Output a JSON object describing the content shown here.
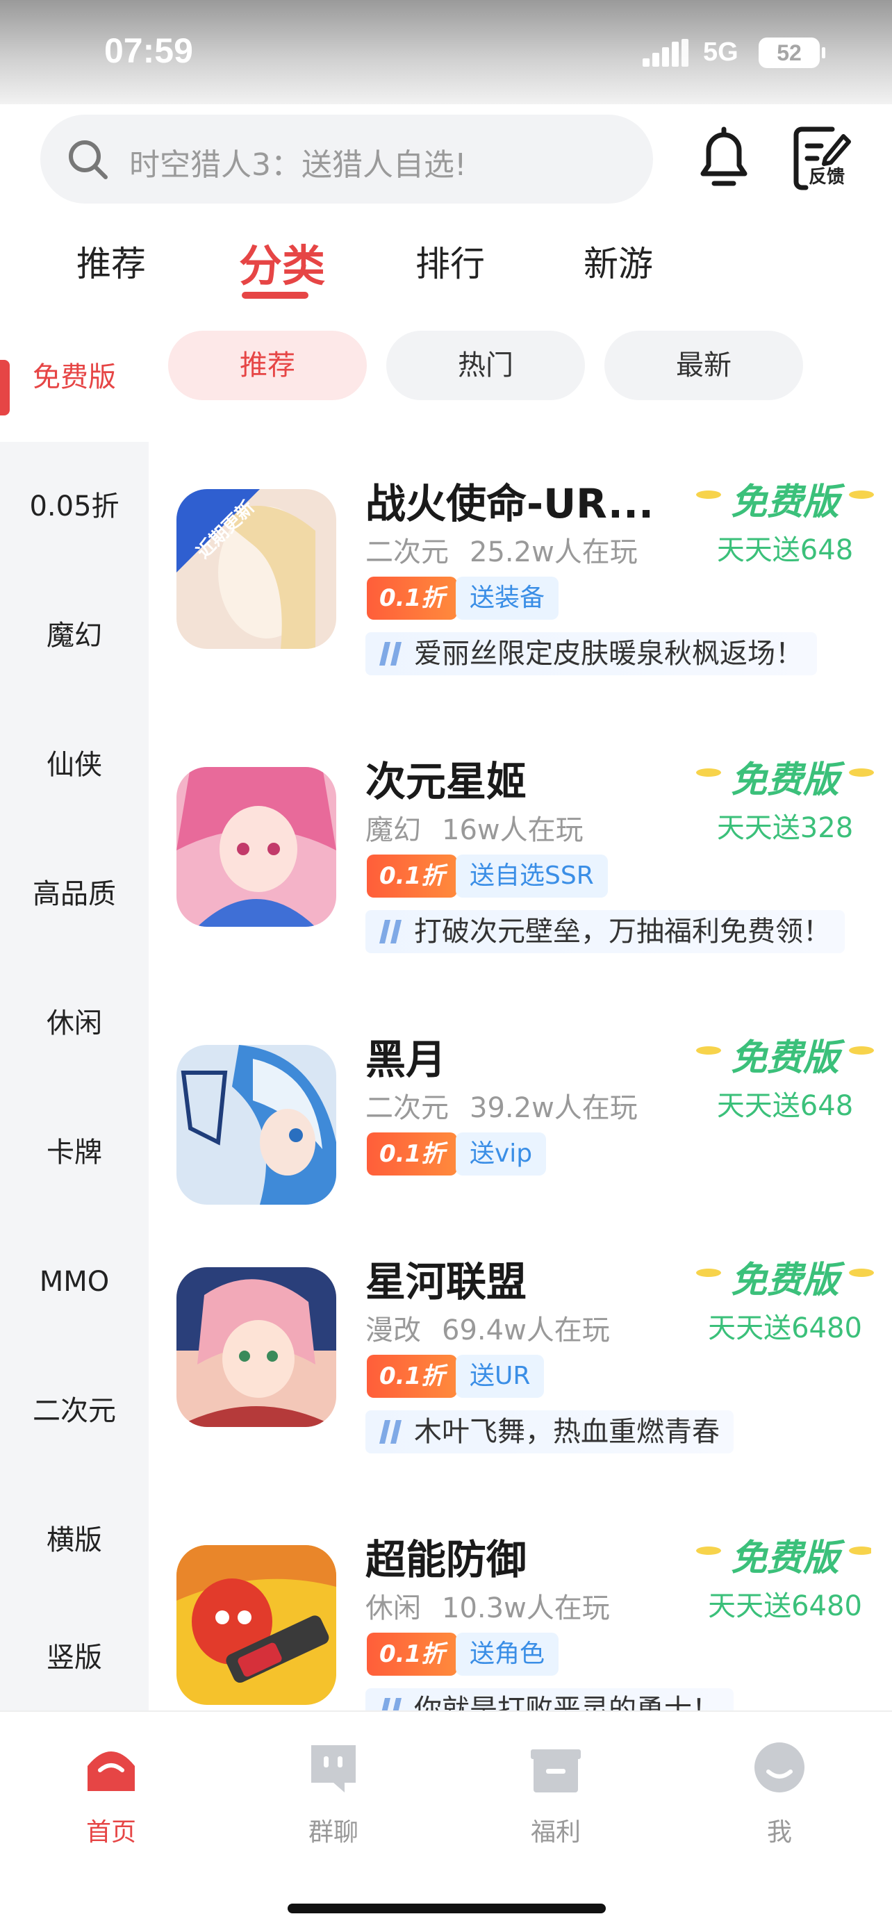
{
  "status_bar": {
    "time": "07:59",
    "network": "5G",
    "battery": "52"
  },
  "search": {
    "placeholder": "时空猎人3：送猎人自选!"
  },
  "header": {
    "feedback_label": "反馈"
  },
  "top_tabs": [
    {
      "label": "推荐"
    },
    {
      "label": "分类",
      "active": true
    },
    {
      "label": "排行"
    },
    {
      "label": "新游"
    }
  ],
  "sidebar": {
    "items": [
      {
        "label": "免费版",
        "active": true
      },
      {
        "label": "0.05折"
      },
      {
        "label": "魔幻"
      },
      {
        "label": "仙侠"
      },
      {
        "label": "高品质"
      },
      {
        "label": "休闲"
      },
      {
        "label": "卡牌"
      },
      {
        "label": "MMO"
      },
      {
        "label": "二次元"
      },
      {
        "label": "横版"
      },
      {
        "label": "竖版"
      }
    ]
  },
  "filters": [
    {
      "label": "推荐",
      "active": true
    },
    {
      "label": "热门"
    },
    {
      "label": "最新"
    }
  ],
  "games": [
    {
      "title": "战火使命-UR...",
      "genre": "二次元",
      "players": "25.2w人在玩",
      "discount": "0.1折",
      "gift": "送装备",
      "desc": "爱丽丝限定皮肤暖泉秋枫返场！",
      "version": "免费版",
      "bonus": "天天送648",
      "icon_badge": "近期更新",
      "icon_color": "#f3e2d6"
    },
    {
      "title": "次元星姬",
      "genre": "魔幻",
      "players": "16w人在玩",
      "discount": "0.1折",
      "gift": "送自选SSR",
      "desc": "打破次元壁垒，万抽福利免费领！",
      "version": "免费版",
      "bonus": "天天送328",
      "icon_color": "#f4b3c8"
    },
    {
      "title": "黑月",
      "genre": "二次元",
      "players": "39.2w人在玩",
      "discount": "0.1折",
      "gift": "送vip",
      "desc": "",
      "version": "免费版",
      "bonus": "天天送648",
      "icon_color": "#d9e6f4"
    },
    {
      "title": "星河联盟",
      "genre": "漫改",
      "players": "69.4w人在玩",
      "discount": "0.1折",
      "gift": "送UR",
      "desc": "木叶飞舞，热血重燃青春",
      "version": "免费版",
      "bonus": "天天送6480",
      "icon_color": "#f3c7b8"
    },
    {
      "title": "超能防御",
      "genre": "休闲",
      "players": "10.3w人在玩",
      "discount": "0.1折",
      "gift": "送角色",
      "desc": "你就是打败恶灵的勇士！",
      "version": "免费版",
      "bonus": "天天送6480",
      "icon_color": "#f5c22c"
    }
  ],
  "bottom_nav": [
    {
      "label": "首页",
      "icon": "home-icon",
      "active": true
    },
    {
      "label": "群聊",
      "icon": "chat-icon"
    },
    {
      "label": "福利",
      "icon": "gift-icon"
    },
    {
      "label": "我",
      "icon": "profile-icon"
    }
  ],
  "colors": {
    "accent": "#e64545",
    "green": "#3bc07a",
    "blue_tag": "#3a8ee6"
  }
}
